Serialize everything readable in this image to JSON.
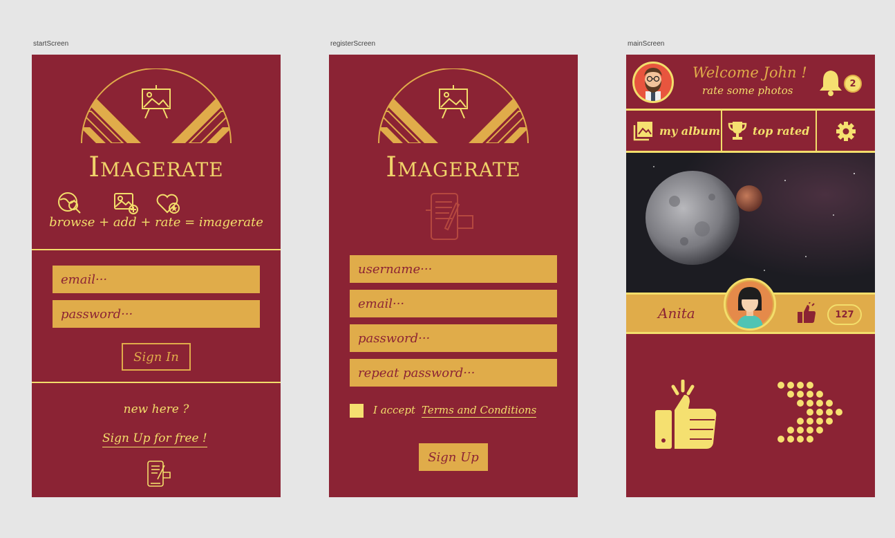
{
  "artboards": {
    "start": "startScreen",
    "register": "registerScreen",
    "main": "mainScreen"
  },
  "colors": {
    "background": "#e6e6e6",
    "screen": "#8b2334",
    "gold": "#e0ac4a",
    "yellow": "#f3de6b"
  },
  "start": {
    "logo_text": "Imagerate",
    "icons": [
      "globe-search-icon",
      "add-image-icon",
      "heart-star-icon"
    ],
    "tagline": "browse + add + rate = imagerate",
    "email_placeholder": "email···",
    "password_placeholder": "password···",
    "sign_in": "Sign In",
    "new_here": "new here ?",
    "sign_up_link": "Sign Up for free !"
  },
  "register": {
    "logo_text": "Imagerate",
    "username_placeholder": "username···",
    "email_placeholder": "email···",
    "password_placeholder": "password···",
    "repeat_password_placeholder": "repeat password···",
    "accept_prefix": "I accept",
    "terms_link": "Terms and Conditions",
    "sign_up": "Sign Up"
  },
  "main": {
    "welcome": "Welcome John !",
    "subtitle": "rate some photos",
    "notification_count": "2",
    "nav": {
      "my_album": "my album",
      "top_rated": "top rated"
    },
    "photo_author": "Anita",
    "like_count": "127"
  }
}
